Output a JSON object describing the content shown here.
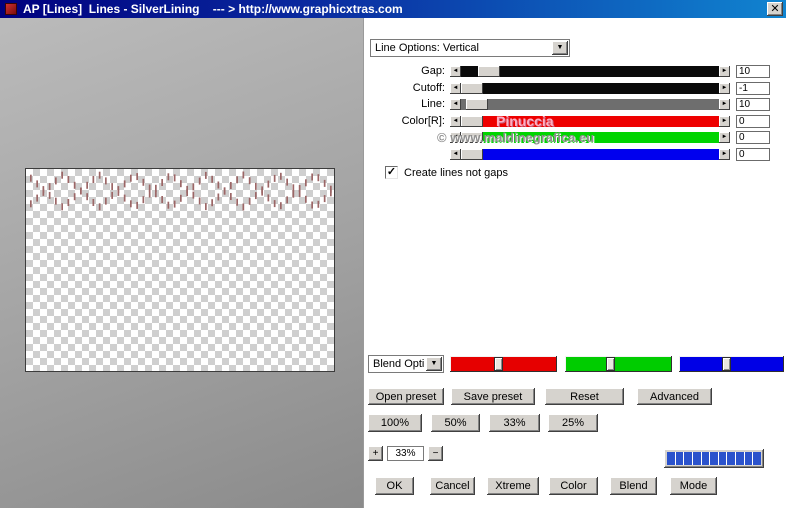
{
  "window": {
    "title": "AP [Lines]  Lines - SilverLining    --- > http://www.graphicxtras.com"
  },
  "icons": {
    "close": "✕",
    "dropdown": "▼",
    "left_arrow": "◄",
    "right_arrow": "►",
    "check": "✓",
    "plus": "+",
    "minus": "−"
  },
  "preview": {
    "pattern_color": "#9c6666"
  },
  "controls": {
    "line_options_value": "Line Options: Vertical",
    "sliders": [
      {
        "label": "Gap:",
        "value": "10",
        "track": "#0a0a0a",
        "thumb_pos": 0.07
      },
      {
        "label": "Cutoff:",
        "value": "-1",
        "track": "#0a0a0a",
        "thumb_pos": 0.0
      },
      {
        "label": "Line:",
        "value": "10",
        "track": "#6e6e6e",
        "thumb_pos": 0.02
      },
      {
        "label": "Color[R]:",
        "value": "0",
        "track": "#ee0000",
        "thumb_pos": 0.0
      },
      {
        "label": "",
        "value": "0",
        "track": "#00d400",
        "thumb_pos": 0.0
      },
      {
        "label": "",
        "value": "0",
        "track": "#0000ee",
        "thumb_pos": 0.0
      }
    ],
    "checkbox_label": "Create lines not gaps",
    "checkbox_checked": true,
    "blend_dropdown_value": "Blend Opti",
    "rgb_sliders": [
      {
        "color": "#e60000",
        "thumb_pos": 0.45
      },
      {
        "color": "#00cc00",
        "thumb_pos": 0.42
      },
      {
        "color": "#0000e6",
        "thumb_pos": 0.45
      }
    ],
    "preset_buttons": [
      "Open preset",
      "Save preset",
      "Reset",
      "Advanced"
    ],
    "zoom_buttons": [
      "100%",
      "50%",
      "33%",
      "25%"
    ],
    "zoom_value": "33%",
    "progress": {
      "segments": 11,
      "color": "#2a52cc"
    },
    "bottom_buttons": [
      "OK",
      "Cancel",
      "Xtreme",
      "Color",
      "Blend",
      "Mode"
    ]
  },
  "watermark": {
    "line1": "Pinuccia",
    "line2": "© www.maldinegrafica.eu"
  }
}
